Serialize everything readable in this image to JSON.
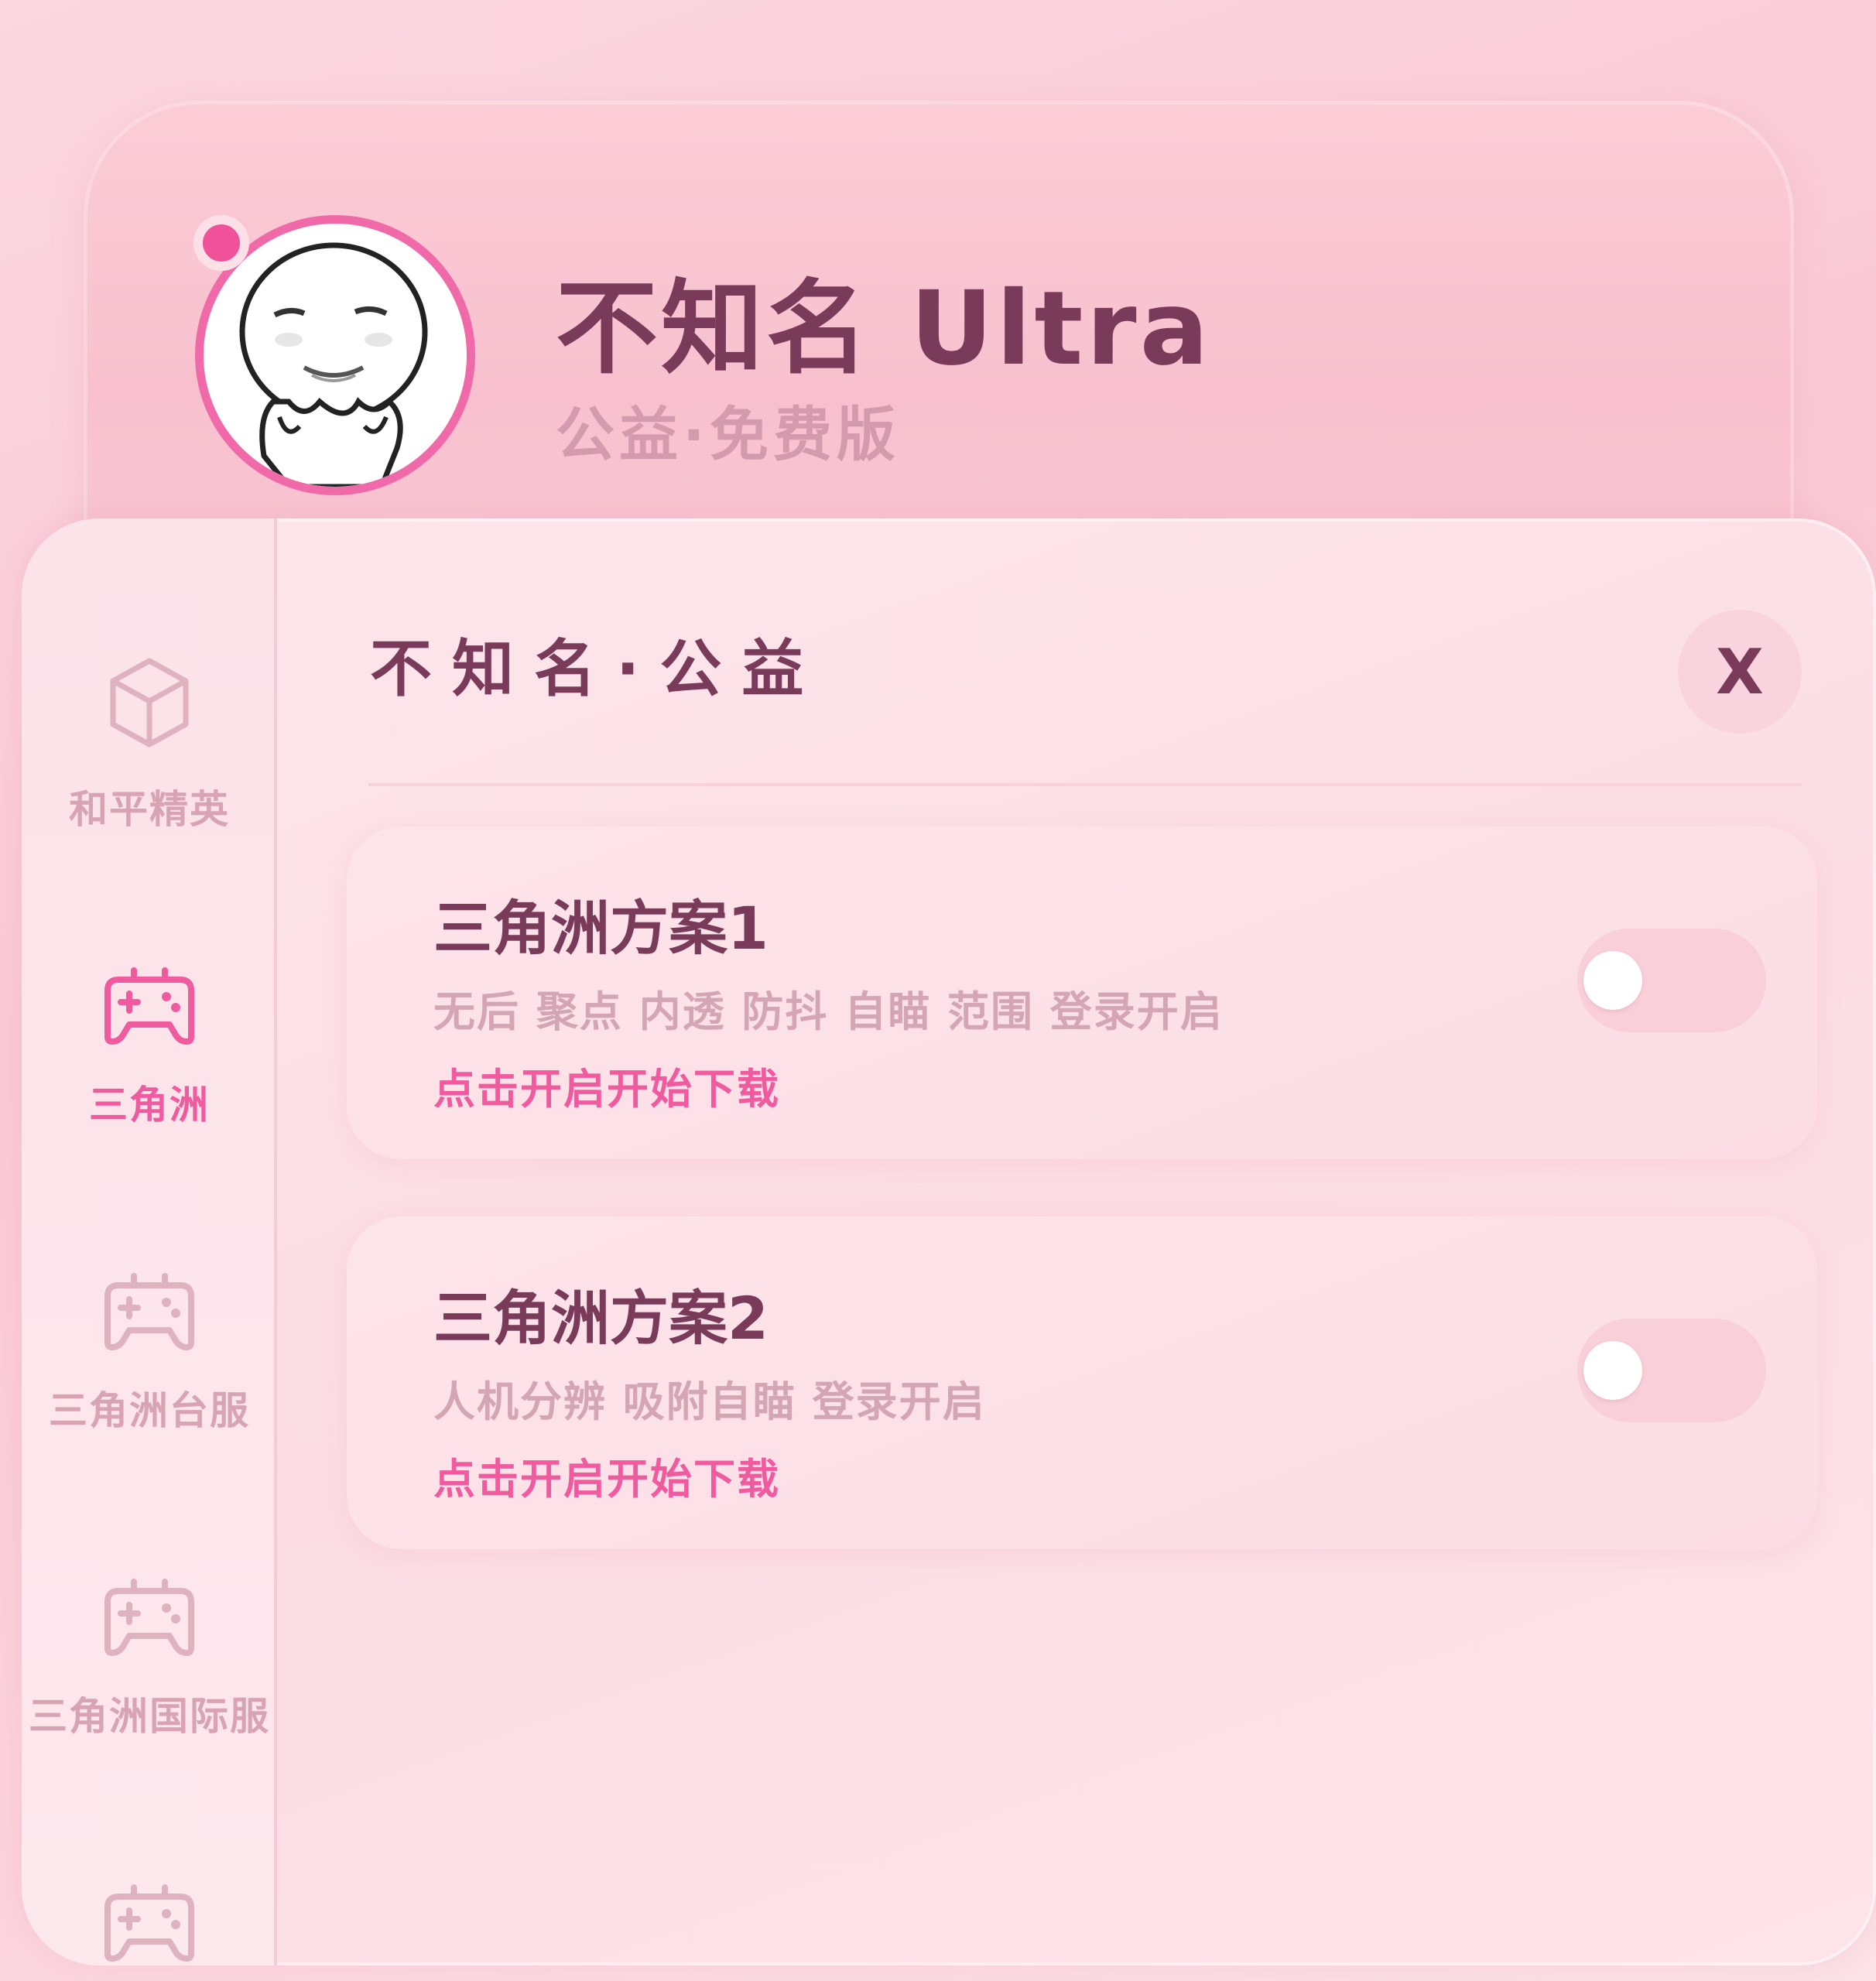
{
  "header": {
    "title": "不知名 Ultra",
    "subtitle": "公益·免费版"
  },
  "panel": {
    "title": "不知名·公益",
    "close_label": "X"
  },
  "sidebar": {
    "items": [
      {
        "label": "和平精英",
        "icon": "cube-icon",
        "active": false
      },
      {
        "label": "三角洲",
        "icon": "gamepad-icon",
        "active": true
      },
      {
        "label": "三角洲台服",
        "icon": "gamepad-icon",
        "active": false
      },
      {
        "label": "三角洲国际服",
        "icon": "gamepad-icon",
        "active": false
      },
      {
        "label": "",
        "icon": "gamepad-icon",
        "active": false
      }
    ]
  },
  "options": [
    {
      "title": "三角洲方案1",
      "description": "无后 聚点 内透 防抖 自瞄 范围 登录开启",
      "action": "点击开启开始下载",
      "enabled": false
    },
    {
      "title": "三角洲方案2",
      "description": "人机分辨 吸附自瞄 登录开启",
      "action": "点击开启开始下载",
      "enabled": false
    }
  ],
  "colors": {
    "accent": "#f05a9e",
    "title_text": "#7a3a5a",
    "muted_text": "#d4a5b4",
    "background": "#fbd3dc"
  }
}
